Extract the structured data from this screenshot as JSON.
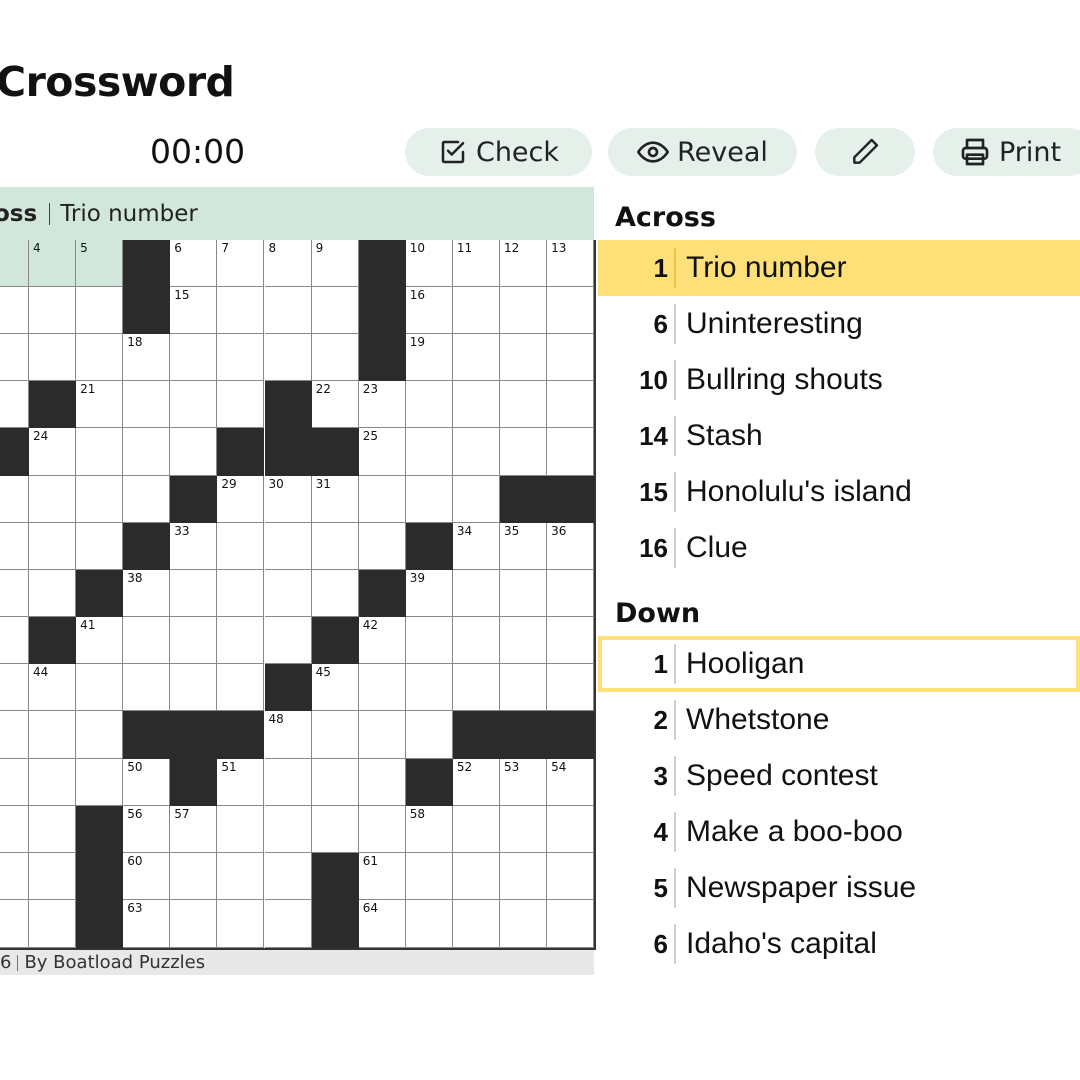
{
  "app": {
    "title": "Crossword"
  },
  "timer": "00:00",
  "toolbar": {
    "check_label": "Check",
    "reveal_label": "Reveal",
    "print_label": "Print",
    "icons": [
      "check-square-icon",
      "eye-icon",
      "pencil-icon",
      "printer-icon"
    ]
  },
  "current_clue": {
    "direction": "oss",
    "text": "Trio number"
  },
  "footer": {
    "prefix": "6",
    "byline": "By Boatload Puzzles"
  },
  "grid": {
    "rows": [
      [
        {
          "n": null,
          "hl": true
        },
        {
          "n": "4",
          "hl": true
        },
        {
          "n": "5",
          "hl": true
        },
        {
          "b": true
        },
        {
          "n": "6"
        },
        {
          "n": "7"
        },
        {
          "n": "8"
        },
        {
          "n": "9"
        },
        {
          "b": true
        },
        {
          "n": "10"
        },
        {
          "n": "11"
        },
        {
          "n": "12"
        },
        {
          "n": "13"
        }
      ],
      [
        {},
        {},
        {},
        {
          "b": true
        },
        {
          "n": "15"
        },
        {},
        {},
        {},
        {
          "b": true
        },
        {
          "n": "16"
        },
        {},
        {},
        {}
      ],
      [
        {},
        {},
        {},
        {
          "n": "18"
        },
        {},
        {},
        {},
        {},
        {
          "b": true
        },
        {
          "n": "19"
        },
        {},
        {},
        {}
      ],
      [
        {},
        {
          "b": true
        },
        {
          "n": "21"
        },
        {},
        {},
        {},
        {
          "b": true
        },
        {
          "n": "22"
        },
        {
          "n": "23"
        },
        {},
        {},
        {},
        {}
      ],
      [
        {
          "b": true
        },
        {
          "n": "24"
        },
        {},
        {},
        {},
        {
          "b": true
        },
        {
          "b": true
        },
        {
          "b": true
        },
        {
          "n": "25"
        },
        {},
        {},
        {},
        {}
      ],
      [
        {},
        {},
        {},
        {},
        {
          "b": true
        },
        {
          "n": "29"
        },
        {
          "n": "30"
        },
        {
          "n": "31"
        },
        {},
        {},
        {},
        {
          "b": true
        },
        {
          "b": true
        }
      ],
      [
        {},
        {},
        {},
        {
          "b": true
        },
        {
          "n": "33"
        },
        {},
        {},
        {},
        {},
        {
          "b": true
        },
        {
          "n": "34"
        },
        {
          "n": "35"
        },
        {
          "n": "36"
        }
      ],
      [
        {},
        {},
        {
          "b": true
        },
        {
          "n": "38"
        },
        {},
        {},
        {},
        {},
        {
          "b": true
        },
        {
          "n": "39"
        },
        {},
        {},
        {}
      ],
      [
        {},
        {
          "b": true
        },
        {
          "n": "41"
        },
        {},
        {},
        {},
        {},
        {
          "b": true
        },
        {
          "n": "42"
        },
        {},
        {},
        {},
        {}
      ],
      [
        {},
        {
          "n": "44"
        },
        {},
        {},
        {},
        {},
        {
          "b": true
        },
        {
          "n": "45"
        },
        {},
        {},
        {},
        {},
        {}
      ],
      [
        {},
        {},
        {},
        {
          "b": true
        },
        {
          "b": true
        },
        {
          "b": true
        },
        {
          "n": "48"
        },
        {},
        {},
        {},
        {
          "b": true
        },
        {
          "b": true
        },
        {
          "b": true
        }
      ],
      [
        {},
        {},
        {},
        {
          "n": "50"
        },
        {
          "b": true
        },
        {
          "n": "51"
        },
        {},
        {},
        {},
        {
          "b": true
        },
        {
          "n": "52"
        },
        {
          "n": "53"
        },
        {
          "n": "54"
        }
      ],
      [
        {},
        {},
        {
          "b": true
        },
        {
          "n": "56"
        },
        {
          "n": "57"
        },
        {},
        {},
        {},
        {},
        {
          "n": "58"
        },
        {},
        {},
        {}
      ],
      [
        {},
        {},
        {
          "b": true
        },
        {
          "n": "60"
        },
        {},
        {},
        {},
        {
          "b": true
        },
        {
          "n": "61"
        },
        {},
        {},
        {},
        {}
      ],
      [
        {},
        {},
        {
          "b": true
        },
        {
          "n": "63"
        },
        {},
        {},
        {},
        {
          "b": true
        },
        {
          "n": "64"
        },
        {},
        {},
        {},
        {}
      ]
    ]
  },
  "clues": {
    "across_title": "Across",
    "down_title": "Down",
    "across": [
      {
        "num": "1",
        "text": "Trio number"
      },
      {
        "num": "6",
        "text": "Uninteresting"
      },
      {
        "num": "10",
        "text": "Bullring shouts"
      },
      {
        "num": "14",
        "text": "Stash"
      },
      {
        "num": "15",
        "text": "Honolulu's island"
      },
      {
        "num": "16",
        "text": "Clue"
      }
    ],
    "down": [
      {
        "num": "1",
        "text": "Hooligan"
      },
      {
        "num": "2",
        "text": "Whetstone"
      },
      {
        "num": "3",
        "text": "Speed contest"
      },
      {
        "num": "4",
        "text": "Make a boo-boo"
      },
      {
        "num": "5",
        "text": "Newspaper issue"
      },
      {
        "num": "6",
        "text": "Idaho's capital"
      }
    ]
  },
  "colors": {
    "accent_green": "#d2e7dc",
    "active_yellow": "#fde078",
    "button_bg": "#e6f0ea",
    "block": "#2b2b2b"
  }
}
